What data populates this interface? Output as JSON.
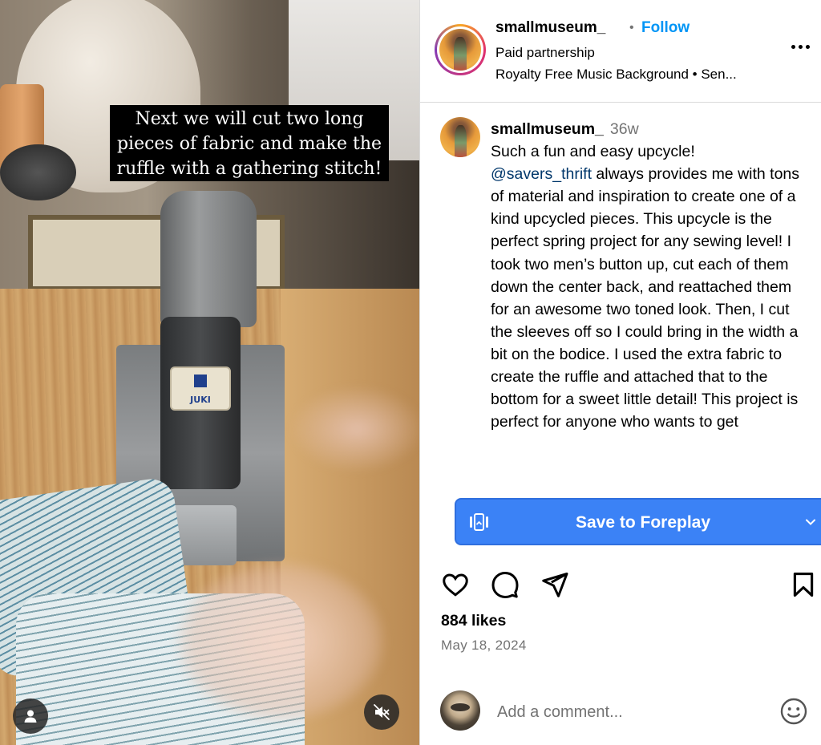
{
  "video": {
    "caption": "Next we will cut two long\npieces of fabric and make the\nruffle with a gathering stitch!",
    "machine_badge": "JUKI"
  },
  "header": {
    "username": "smallmuseum_",
    "separator": "•",
    "follow_label": "Follow",
    "paid_partnership": "Paid partnership",
    "music": "Royalty Free Music Background • Sen..."
  },
  "caption": {
    "username": "smallmuseum_",
    "time": "36w",
    "line1": "Such a fun and easy upcycle!",
    "mention": "@savers_thrift",
    "body": " always provides me with tons of material and inspiration to create one of a kind upcycled pieces. This upcycle is the perfect spring project for any sewing level! I took two men’s button up, cut each of them down the center back, and reattached them for an awesome two toned look. Then, I cut the sleeves off so I could bring in the width a bit on the bodice. I used the extra fabric to create the ruffle and attached that to the bottom for a sweet little detail! This project is perfect for anyone who wants to get"
  },
  "foreplay": {
    "label": "Save to Foreplay",
    "accent": "#3b82f6"
  },
  "post": {
    "likes": "884 likes",
    "date": "May 18, 2024"
  },
  "add_comment": {
    "placeholder": "Add a comment..."
  },
  "colors": {
    "link_blue": "#0095f6",
    "mention_blue": "#00376b",
    "secondary_text": "#737373"
  },
  "icons": [
    "user-icon",
    "mute-icon",
    "more-icon",
    "heart-icon",
    "comment-icon",
    "share-icon",
    "bookmark-icon",
    "foreplay-icon",
    "chevron-down-icon",
    "emoji-icon"
  ]
}
